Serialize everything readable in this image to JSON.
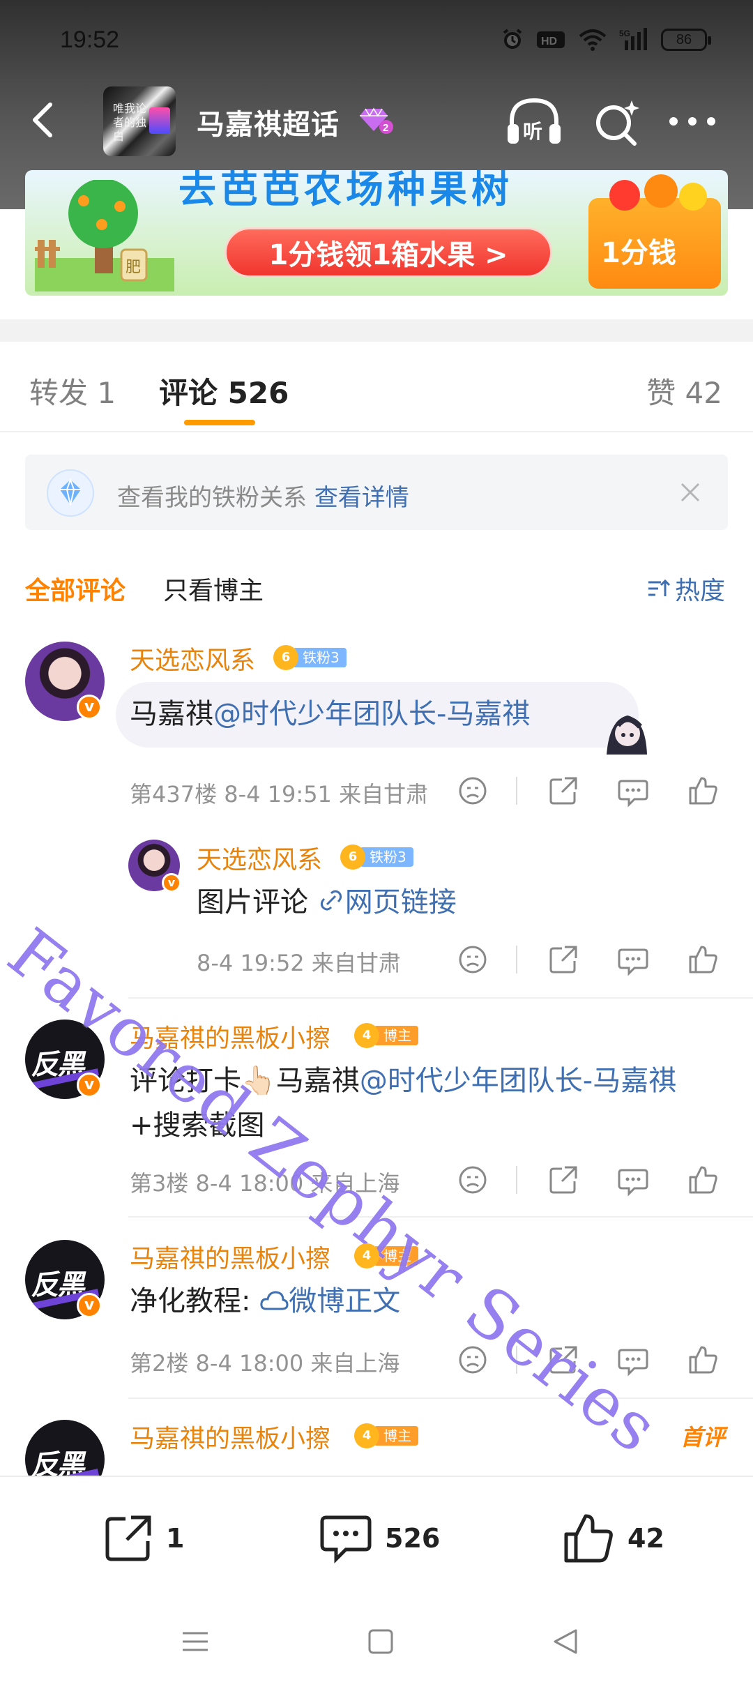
{
  "status_bar": {
    "time": "19:52",
    "network": "5G",
    "battery": "86"
  },
  "header": {
    "topic_thumbnail_text": "唯我论者的独白",
    "title": "马嘉祺超话",
    "level_badge": "2"
  },
  "banner": {
    "title": "去芭芭农场种果树",
    "cta": "1分钱领1箱水果 >",
    "box_label": "1分钱",
    "tree_sign": "肥"
  },
  "tabs": {
    "repost": "转发 1",
    "comment": "评论 526",
    "like": "赞 42"
  },
  "notice": {
    "text": "查看我的铁粉关系",
    "link": "查看详情"
  },
  "filter": {
    "all": "全部评论",
    "host_only": "只看博主",
    "sort": "热度"
  },
  "comments": [
    {
      "username": "天选恋风系",
      "badge_level": "6",
      "badge_label": "铁粉3",
      "text_plain": "马嘉祺",
      "text_link": "@时代少年团队长-马嘉祺",
      "meta": "第437楼  8-4 19:51  来自甘肃"
    },
    {
      "username": "天选恋风系",
      "badge_level": "6",
      "badge_label": "铁粉3",
      "text_plain": "图片评论 ",
      "text_link": "网页链接",
      "meta": "8-4 19:52  来自甘肃"
    },
    {
      "username": "马嘉祺的黑板小擦",
      "badge_level": "4",
      "badge_label": "博主",
      "text_plain": "评论打卡👆🏻马嘉祺",
      "text_link": "@时代少年团队长-马嘉祺",
      "text_tail": " +搜索截图",
      "meta": "第3楼  8-4 18:00  来自上海",
      "avatar_logo": "反黑"
    },
    {
      "username": "马嘉祺的黑板小擦",
      "badge_level": "4",
      "badge_label": "博主",
      "text_plain": "净化教程: ",
      "text_link": "微博正文",
      "meta": "第2楼  8-4 18:00  来自上海",
      "avatar_logo": "反黑"
    },
    {
      "username": "马嘉祺的黑板小擦",
      "badge_level": "4",
      "badge_label": "博主",
      "first_tag": "首评",
      "avatar_logo": "反黑"
    }
  ],
  "watermark": "Favored Zephyr Series",
  "bottom_bar": {
    "repost_count": "1",
    "comment_count": "526",
    "like_count": "42"
  },
  "colors": {
    "accent_orange": "#ff8200",
    "link_blue": "#3f6fb0",
    "username_orange": "#e8830b",
    "watermark_purple": "#785ceb"
  }
}
